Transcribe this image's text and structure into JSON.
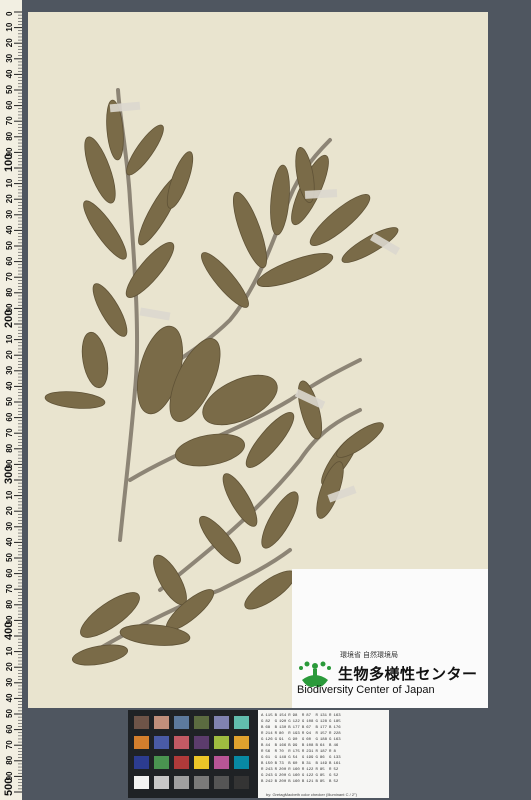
{
  "ruler": {
    "unit_ticks": [
      "0",
      "10",
      "20",
      "30",
      "40",
      "50",
      "60",
      "70",
      "80",
      "90",
      "100",
      "10",
      "20",
      "30",
      "40",
      "50",
      "60",
      "70",
      "80",
      "90",
      "200",
      "10",
      "20",
      "30",
      "40",
      "50",
      "60",
      "70",
      "80",
      "90",
      "300",
      "10",
      "20",
      "30",
      "40",
      "50",
      "60",
      "70",
      "80",
      "90",
      "400",
      "10",
      "20",
      "30",
      "40",
      "50",
      "60",
      "70",
      "80",
      "90",
      "500"
    ]
  },
  "colors": {
    "background": "#4f5660",
    "sheet": "#e9e4cf",
    "leaf": "#7a6b48",
    "stem": "#8d8576"
  },
  "logo": {
    "agency": "環境省 自然環境局",
    "center_jp": "生物多様性センター",
    "center_en": "Biodiversity Center of Japan"
  },
  "calibration": {
    "rows": [
      [
        "A",
        "115",
        "B",
        "154",
        "R",
        "98",
        "R",
        "87",
        "R",
        "131",
        "R",
        "163"
      ],
      [
        "G",
        "82",
        "G",
        "190",
        "G",
        "122",
        "G",
        "108",
        "G",
        "128",
        "G",
        "185"
      ],
      [
        "B",
        "68",
        "B",
        "130",
        "B",
        "177",
        "B",
        "67",
        "B",
        "177",
        "B",
        "176"
      ],
      [
        "R",
        "214",
        "R",
        "80",
        "R",
        "193",
        "R",
        "94",
        "R",
        "157",
        "R",
        "228"
      ],
      [
        "G",
        "126",
        "G",
        "91",
        "G",
        "90",
        "G",
        "60",
        "G",
        "188",
        "G",
        "163"
      ],
      [
        "B",
        "44",
        "B",
        "166",
        "B",
        "99",
        "B",
        "108",
        "B",
        "64",
        "B",
        "46"
      ],
      [
        "R",
        "56",
        "R",
        "70",
        "R",
        "175",
        "R",
        "231",
        "R",
        "187",
        "R",
        "8"
      ],
      [
        "G",
        "61",
        "G",
        "148",
        "G",
        "54",
        "G",
        "199",
        "G",
        "86",
        "G",
        "133"
      ],
      [
        "B",
        "150",
        "B",
        "73",
        "B",
        "60",
        "B",
        "31",
        "B",
        "149",
        "B",
        "161"
      ],
      [
        "R",
        "243",
        "R",
        "200",
        "R",
        "160",
        "R",
        "122",
        "R",
        "85",
        "R",
        "52"
      ],
      [
        "G",
        "243",
        "G",
        "200",
        "G",
        "160",
        "G",
        "122",
        "G",
        "85",
        "G",
        "52"
      ],
      [
        "B",
        "242",
        "B",
        "200",
        "B",
        "160",
        "B",
        "121",
        "B",
        "85",
        "B",
        "52"
      ]
    ],
    "footnote": "by: GretagMacbeth color checker (Illuminant C / 2°)"
  }
}
